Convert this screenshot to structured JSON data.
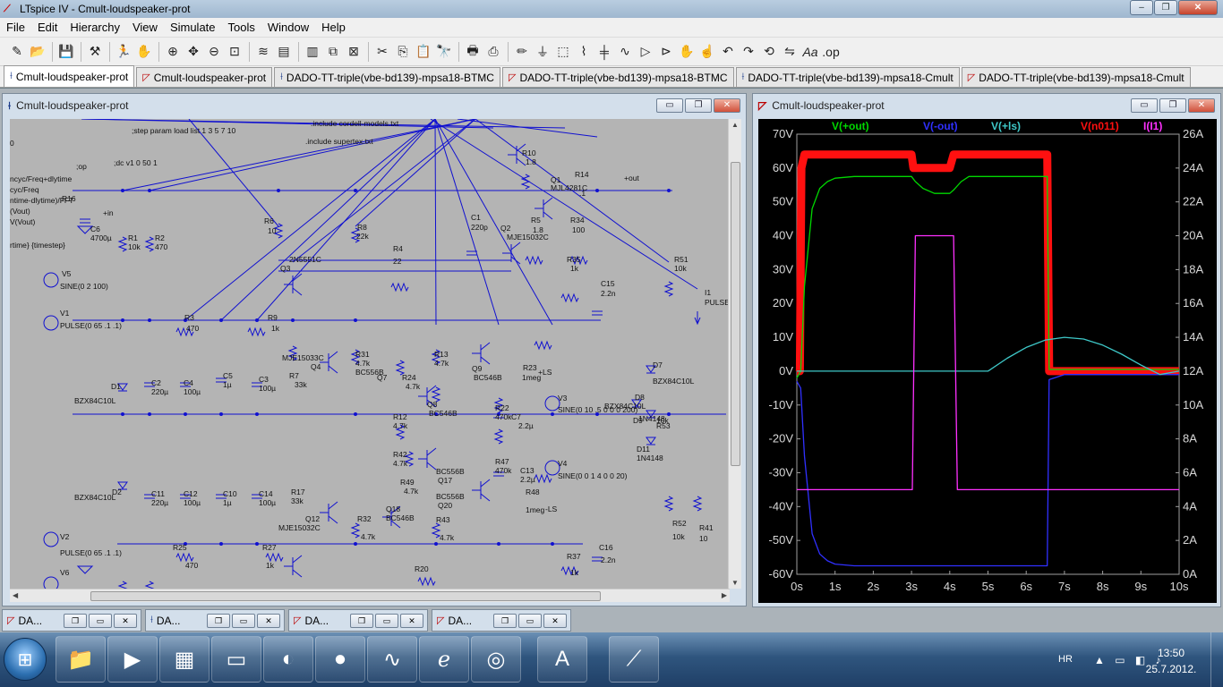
{
  "app": {
    "window_title": "LTspice IV - Cmult-loudspeaker-prot",
    "win_min": "–",
    "win_max": "❐",
    "win_close": "✕"
  },
  "menu": [
    "File",
    "Edit",
    "Hierarchy",
    "View",
    "Simulate",
    "Tools",
    "Window",
    "Help"
  ],
  "toolbar_icons": [
    "new-schematic-icon",
    "open-icon",
    "save-icon",
    "control-panel-icon",
    "run-icon",
    "halt-icon",
    "zoom-in-icon",
    "zoom-pan-icon",
    "zoom-out-icon",
    "zoom-fit-icon",
    "autorange-icon",
    "tile-icon",
    "cascade-icon",
    "close-all-icon",
    "cut-icon",
    "copy-icon",
    "find-icon",
    "print-setup-icon",
    "print-icon",
    "wire-icon",
    "ground-icon",
    "label-icon",
    "resistor-icon",
    "capacitor-icon",
    "inductor-icon",
    "diode-icon",
    "component-icon",
    "move-icon",
    "drag-icon",
    "undo-icon",
    "redo-icon",
    "rotate-icon",
    "mirror-icon",
    "text-icon",
    "spice-directive-icon"
  ],
  "doc_tabs": [
    {
      "label": "Cmult-loudspeaker-prot",
      "kind": "schematic",
      "active": true
    },
    {
      "label": "Cmult-loudspeaker-prot",
      "kind": "waveform",
      "active": false
    },
    {
      "label": "DADO-TT-triple(vbe-bd139)-mpsa18-BTMC",
      "kind": "schematic",
      "active": false
    },
    {
      "label": "DADO-TT-triple(vbe-bd139)-mpsa18-BTMC",
      "kind": "waveform",
      "active": false
    },
    {
      "label": "DADO-TT-triple(vbe-bd139)-mpsa18-Cmult",
      "kind": "schematic",
      "active": false
    },
    {
      "label": "DADO-TT-triple(vbe-bd139)-mpsa18-Cmult",
      "kind": "waveform",
      "active": false
    }
  ],
  "schematic_window": {
    "title": "Cmult-loudspeaker-prot",
    "btn_min": "▭",
    "btn_restore": "❐",
    "btn_close": "✕",
    "directives": [
      ".include cordell-models.txt",
      ";step param load list 1 3 5 7 10",
      ".include supertex.txt",
      ";op",
      ";dc v1 0 50 1",
      "ncyc/Freq+dlytime",
      "cyc/Freq",
      "ntime-dlytime)/FFT",
      "(Vout)",
      "V(Vout)",
      "rtime} {timestep}",
      "0"
    ],
    "parts": [
      {
        "t": "R10"
      },
      {
        "t": "1.8"
      },
      {
        "t": "Q1"
      },
      {
        "t": "MJL4281C"
      },
      {
        "t": "R14"
      },
      {
        "t": ".1"
      },
      {
        "t": "+out"
      },
      {
        "t": "C1"
      },
      {
        "t": "220p"
      },
      {
        "t": "Q2"
      },
      {
        "t": "MJE15032C"
      },
      {
        "t": "R5"
      },
      {
        "t": "1.8"
      },
      {
        "t": "R34"
      },
      {
        "t": "100"
      },
      {
        "t": "R6"
      },
      {
        "t": "10"
      },
      {
        "t": "R8"
      },
      {
        "t": "22k"
      },
      {
        "t": "Q3"
      },
      {
        "t": "2N5551C"
      },
      {
        "t": "R4"
      },
      {
        "t": "22"
      },
      {
        "t": "R35"
      },
      {
        "t": "1k"
      },
      {
        "t": "C15"
      },
      {
        "t": "2.2n"
      },
      {
        "t": "R51"
      },
      {
        "t": "10k"
      },
      {
        "t": "I1"
      },
      {
        "t": "PULSE"
      },
      {
        "t": "R1"
      },
      {
        "t": "10k"
      },
      {
        "t": "R2"
      },
      {
        "t": "470"
      },
      {
        "t": "C6"
      },
      {
        "t": "4700µ"
      },
      {
        "t": "R16"
      },
      {
        "t": "+in"
      },
      {
        "t": "V5"
      },
      {
        "t": "SINE(0 2 100)"
      },
      {
        "t": "V1"
      },
      {
        "t": "PULSE(0 65 .1 .1)"
      },
      {
        "t": "R3"
      },
      {
        "t": "470"
      },
      {
        "t": "R9"
      },
      {
        "t": "1k"
      },
      {
        "t": "MJE15033C"
      },
      {
        "t": "Q4"
      },
      {
        "t": "R7"
      },
      {
        "t": "33k"
      },
      {
        "t": "R31"
      },
      {
        "t": "4.7k"
      },
      {
        "t": "BC556B"
      },
      {
        "t": "Q7"
      },
      {
        "t": "R13"
      },
      {
        "t": "4.7k"
      },
      {
        "t": "Q9"
      },
      {
        "t": "BC546B"
      },
      {
        "t": "R23"
      },
      {
        "t": "1meg"
      },
      {
        "t": "+LS"
      },
      {
        "t": "R24"
      },
      {
        "t": "4.7k"
      },
      {
        "t": "Q8"
      },
      {
        "t": "BC546B"
      },
      {
        "t": "D1"
      },
      {
        "t": "BZX84C10L"
      },
      {
        "t": "C2"
      },
      {
        "t": "220µ"
      },
      {
        "t": "C4"
      },
      {
        "t": "100µ"
      },
      {
        "t": "C5"
      },
      {
        "t": "1µ"
      },
      {
        "t": "C3"
      },
      {
        "t": "100µ"
      },
      {
        "t": "R12"
      },
      {
        "t": "4.7k"
      },
      {
        "t": "R22"
      },
      {
        "t": "470k"
      },
      {
        "t": "C7"
      },
      {
        "t": "2.2µ"
      },
      {
        "t": "V3"
      },
      {
        "t": "SINE(0 10 .5 0 0 0 200)"
      },
      {
        "t": "D7"
      },
      {
        "t": "BZX84C10L"
      },
      {
        "t": "D8"
      },
      {
        "t": "BZX84C10L"
      },
      {
        "t": "D9"
      },
      {
        "t": "1N4148"
      },
      {
        "t": "R53"
      },
      {
        "t": "10k"
      },
      {
        "t": "D11"
      },
      {
        "t": "1N4148"
      },
      {
        "t": "R42"
      },
      {
        "t": "4.7k"
      },
      {
        "t": "R47"
      },
      {
        "t": "470k"
      },
      {
        "t": "C13"
      },
      {
        "t": "2.2µ"
      },
      {
        "t": "V4"
      },
      {
        "t": "SINE(0 0 1 4 0 0 20)"
      },
      {
        "t": "BC556B"
      },
      {
        "t": "Q17"
      },
      {
        "t": "R49"
      },
      {
        "t": "4.7k"
      },
      {
        "t": "BC556B"
      },
      {
        "t": "Q20"
      },
      {
        "t": "R48"
      },
      {
        "t": "1meg"
      },
      {
        "t": "-LS"
      },
      {
        "t": "D2"
      },
      {
        "t": "BZX84C10L"
      },
      {
        "t": "C11"
      },
      {
        "t": "220µ"
      },
      {
        "t": "C12"
      },
      {
        "t": "100µ"
      },
      {
        "t": "C10"
      },
      {
        "t": "1µ"
      },
      {
        "t": "C14"
      },
      {
        "t": "100µ"
      },
      {
        "t": "R17"
      },
      {
        "t": "33k"
      },
      {
        "t": "Q12"
      },
      {
        "t": "MJE15032C"
      },
      {
        "t": "R32"
      },
      {
        "t": "4.7k"
      },
      {
        "t": "Q18"
      },
      {
        "t": "BC546B"
      },
      {
        "t": "R43"
      },
      {
        "t": "4.7k"
      },
      {
        "t": "V2"
      },
      {
        "t": "PULSE(0 65 .1 .1)"
      },
      {
        "t": "R25"
      },
      {
        "t": "470"
      },
      {
        "t": "R27"
      },
      {
        "t": "1k"
      },
      {
        "t": "R37"
      },
      {
        "t": "1k"
      },
      {
        "t": "C16"
      },
      {
        "t": "2.2n"
      },
      {
        "t": "R52"
      },
      {
        "t": "10k"
      },
      {
        "t": "R41"
      },
      {
        "t": "10"
      },
      {
        "t": "V6"
      },
      {
        "t": "SINE(0 2 100)"
      },
      {
        "t": "R20"
      },
      {
        "t": "22"
      },
      {
        "t": "R15"
      },
      {
        "t": "10k"
      },
      {
        "t": "R18"
      },
      {
        "t": "470"
      },
      {
        "t": "Q11"
      },
      {
        "t": "2N5401C"
      },
      {
        "t": "R26"
      },
      {
        "t": "R21"
      },
      {
        "t": "R36"
      },
      {
        "t": "C8"
      },
      {
        "t": "R19"
      }
    ]
  },
  "waveform_window": {
    "title": "Cmult-loudspeaker-prot",
    "btn_min": "▭",
    "btn_restore": "❐",
    "btn_close": "✕"
  },
  "chart_data": {
    "type": "line",
    "title": "",
    "xlabel": "",
    "x_ticks": [
      "0s",
      "1s",
      "2s",
      "3s",
      "4s",
      "5s",
      "6s",
      "7s",
      "8s",
      "9s",
      "10s"
    ],
    "xlim": [
      0,
      10
    ],
    "y_left_ticks": [
      "70V",
      "60V",
      "50V",
      "40V",
      "30V",
      "20V",
      "10V",
      "0V",
      "-10V",
      "-20V",
      "-30V",
      "-40V",
      "-50V",
      "-60V"
    ],
    "ylim_left": [
      -60,
      70
    ],
    "y_right_ticks": [
      "26A",
      "24A",
      "22A",
      "20A",
      "18A",
      "16A",
      "14A",
      "12A",
      "10A",
      "8A",
      "6A",
      "4A",
      "2A",
      "0A"
    ],
    "ylim_right": [
      0,
      26
    ],
    "grid": false,
    "legend_placement": "top",
    "background": "#000000",
    "axis_color": "#a0a0a0",
    "series": [
      {
        "name": "V(+out)",
        "color": "#00d800",
        "axis": "left",
        "x": [
          0,
          0.1,
          0.2,
          0.4,
          0.6,
          0.8,
          1.0,
          1.5,
          2.0,
          3.0,
          3.1,
          3.3,
          3.6,
          4.0,
          4.1,
          4.3,
          4.5,
          5.0,
          6.0,
          6.55,
          6.6,
          7.0,
          8.0,
          9.0,
          10.0
        ],
        "y": [
          -2,
          0,
          25,
          48,
          54,
          56,
          57,
          57.5,
          57.5,
          57.5,
          56,
          54,
          52.5,
          52.5,
          53.5,
          56,
          57.5,
          57.5,
          57.5,
          57.5,
          0.5,
          0.5,
          0.5,
          0.5,
          0.5
        ]
      },
      {
        "name": "V(-out)",
        "color": "#3030ff",
        "axis": "left",
        "x": [
          0,
          0.1,
          0.2,
          0.4,
          0.6,
          0.8,
          1.0,
          1.5,
          2.0,
          3.0,
          4.0,
          5.0,
          6.0,
          6.55,
          6.6,
          7.0,
          8.0,
          9.0,
          10.0
        ],
        "y": [
          -3,
          -5,
          -25,
          -48,
          -54,
          -56,
          -57,
          -57.5,
          -57.5,
          -57.5,
          -57.5,
          -57.5,
          -57.5,
          -57.5,
          -2.5,
          -1,
          -1,
          -1,
          -1
        ]
      },
      {
        "name": "V(+ls)",
        "color": "#3ec8c8",
        "axis": "left",
        "x": [
          0,
          1,
          2,
          3,
          4,
          5.0,
          5.5,
          6.0,
          6.5,
          7.0,
          7.5,
          8.0,
          8.5,
          9.0,
          9.5,
          10.0
        ],
        "y": [
          0,
          0,
          0,
          0,
          0,
          0,
          3.8,
          7,
          9.2,
          10,
          9.5,
          7.7,
          5,
          1.8,
          -1,
          0
        ]
      },
      {
        "name": "V(n011)",
        "color": "#ff1010",
        "axis": "left",
        "x": [
          0,
          0.08,
          0.12,
          0.2,
          3.0,
          3.05,
          4.0,
          4.1,
          6.55,
          6.6,
          7.0,
          10.0
        ],
        "y": [
          0,
          0,
          60,
          64,
          64,
          60,
          60,
          64,
          64,
          0,
          0,
          0
        ]
      },
      {
        "name": "I(I1)",
        "color": "#ff30ff",
        "axis": "right",
        "x": [
          0,
          3.0,
          3.02,
          3.1,
          4.0,
          4.1,
          4.2,
          5.0,
          10.0
        ],
        "y": [
          5,
          5,
          5,
          20,
          20,
          20,
          5,
          5,
          5
        ]
      }
    ]
  },
  "minimized_windows": [
    {
      "label": "DA...",
      "kind": "waveform"
    },
    {
      "label": "DA...",
      "kind": "schematic"
    },
    {
      "label": "DA...",
      "kind": "waveform"
    },
    {
      "label": "DA...",
      "kind": "waveform"
    }
  ],
  "taskbar": {
    "start_icon": "windows-logo-icon",
    "pinned": [
      "explorer-icon",
      "media-player-icon",
      "office-icon",
      "image-viewer-icon",
      "audio-tool-icon",
      "antivirus-icon",
      "oscilloscope-icon",
      "ie-icon",
      "browser-icon",
      "wordpad-icon",
      "ltspice-icon"
    ],
    "lang": "HR",
    "tray_icons": "▲ ▭ ◧ ♪",
    "time": "13:50",
    "date": "25.7.2012."
  }
}
